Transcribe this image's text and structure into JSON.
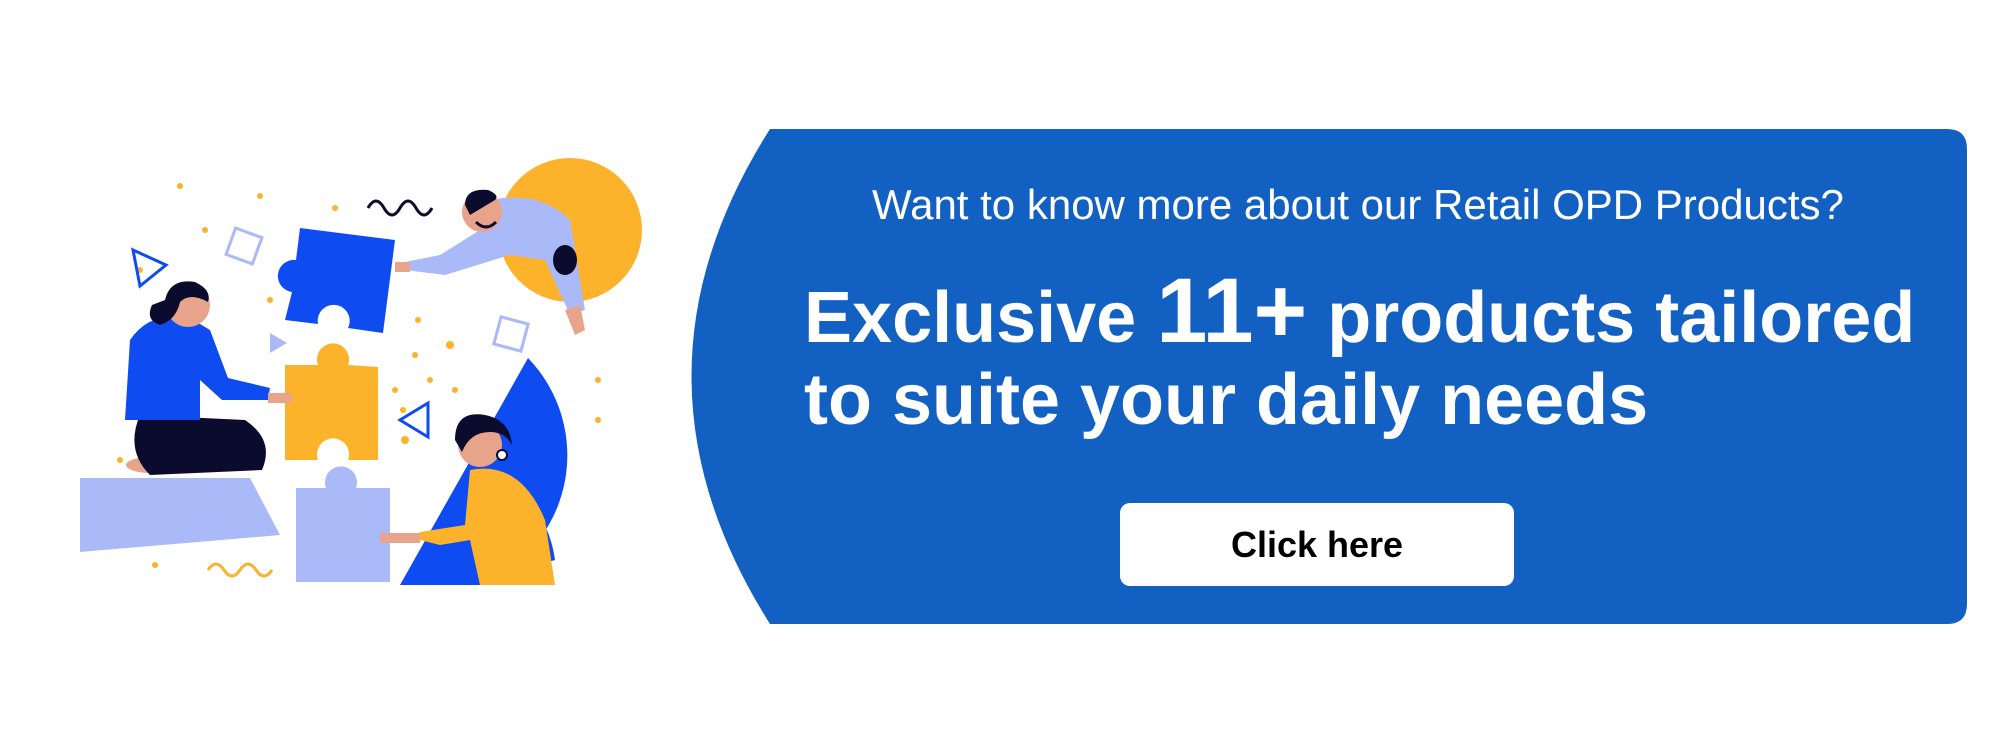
{
  "banner": {
    "subtitle": "Want to know more about our Retail OPD Products?",
    "headline_prefix": "Exclusive ",
    "headline_number": "11+",
    "headline_rest_line1": " products tailored",
    "headline_line2": "to suite your daily needs",
    "cta_label": "Click here"
  },
  "illustration": {
    "description_icons": [
      "puzzle-piece-icon",
      "person-icon",
      "triangle-icon",
      "square-icon",
      "squiggle-icon",
      "confetti-dot-icon"
    ]
  },
  "colors": {
    "panel_blue": "#1260C2",
    "puzzle_blue": "#0E4BF1",
    "puzzle_yellow": "#FDB22C",
    "puzzle_lavender": "#AAB9F8",
    "dark_navy": "#0B0B2E",
    "skin": "#E8A48B",
    "text_white": "#FFFFFF",
    "button_white": "#FFFFFF"
  }
}
